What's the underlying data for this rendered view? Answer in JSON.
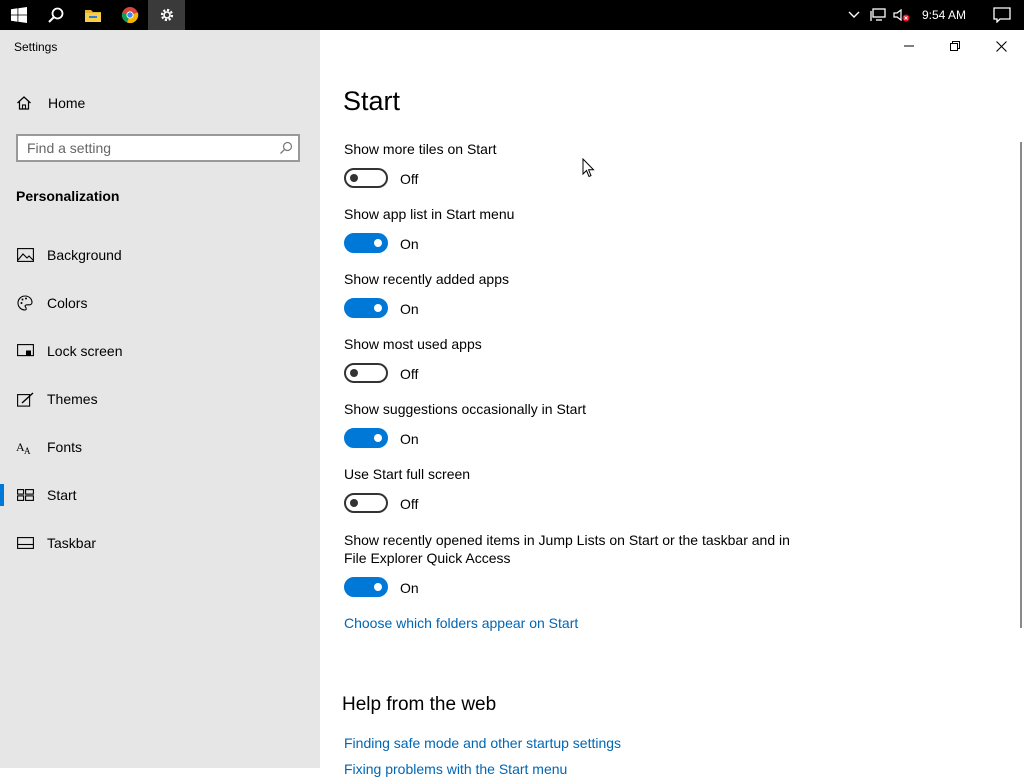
{
  "taskbar": {
    "clock": "9:54 AM",
    "icons": [
      "windows-start-icon",
      "search-icon",
      "file-explorer-icon",
      "chrome-icon",
      "settings-gear-icon"
    ],
    "tray_icons": [
      "chevron-up-icon",
      "network-icon",
      "volume-muted-icon",
      "action-center-icon"
    ]
  },
  "window": {
    "app_title": "Settings",
    "controls": [
      "minimize-icon",
      "restore-icon",
      "close-icon"
    ]
  },
  "sidebar": {
    "home": "Home",
    "search_placeholder": "Find a setting",
    "section": "Personalization",
    "items": [
      {
        "label": "Background",
        "icon": "picture-icon"
      },
      {
        "label": "Colors",
        "icon": "palette-icon"
      },
      {
        "label": "Lock screen",
        "icon": "lock-screen-icon"
      },
      {
        "label": "Themes",
        "icon": "themes-icon"
      },
      {
        "label": "Fonts",
        "icon": "fonts-icon"
      },
      {
        "label": "Start",
        "icon": "start-icon",
        "selected": true
      },
      {
        "label": "Taskbar",
        "icon": "taskbar-icon"
      }
    ]
  },
  "main": {
    "title": "Start",
    "settings": [
      {
        "label": "Show more tiles on Start",
        "state": "Off"
      },
      {
        "label": "Show app list in Start menu",
        "state": "On"
      },
      {
        "label": "Show recently added apps",
        "state": "On"
      },
      {
        "label": "Show most used apps",
        "state": "Off"
      },
      {
        "label": "Show suggestions occasionally in Start",
        "state": "On"
      },
      {
        "label": "Use Start full screen",
        "state": "Off"
      },
      {
        "label": "Show recently opened items in Jump Lists on Start or the taskbar and in File Explorer Quick Access",
        "state": "On"
      }
    ],
    "folders_link": "Choose which folders appear on Start",
    "help_heading": "Help from the web",
    "help_links": [
      "Finding safe mode and other startup settings",
      "Fixing problems with the Start menu"
    ]
  },
  "colors": {
    "accent": "#0078d7",
    "link": "#0066b4",
    "sidebar_bg": "#e6e6e6"
  }
}
